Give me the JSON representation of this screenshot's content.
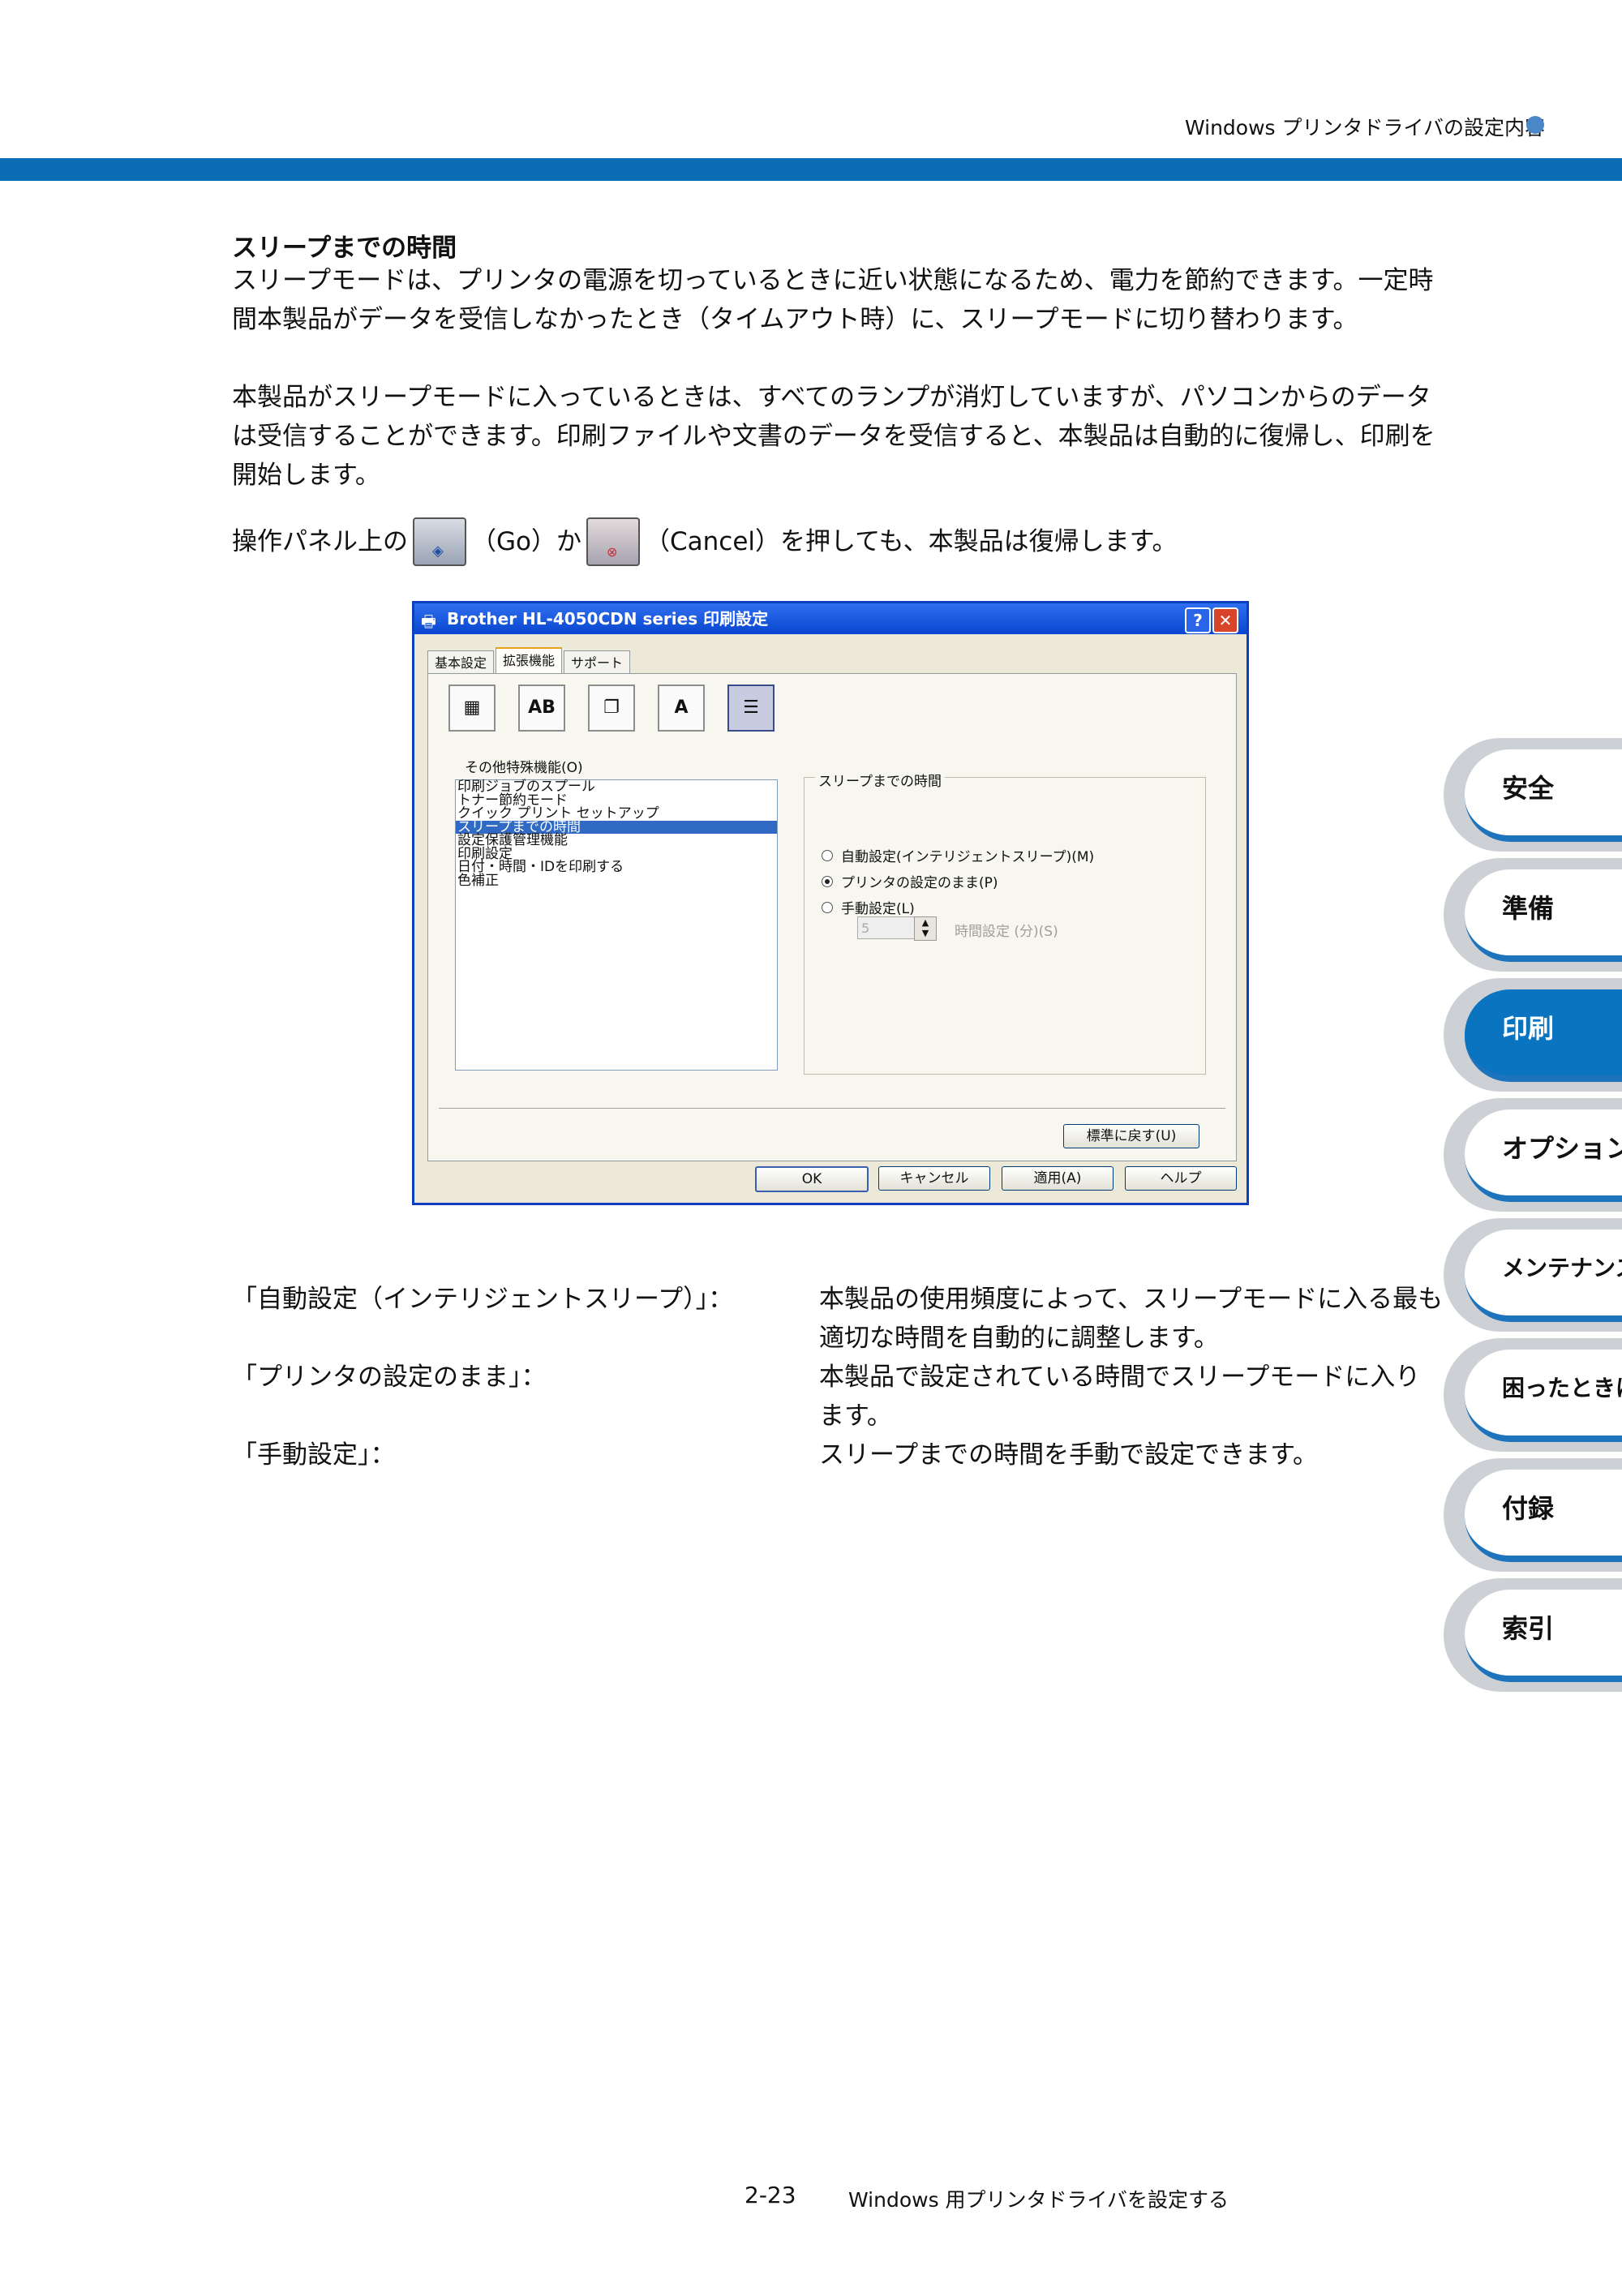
{
  "header": {
    "title": "Windows プリンタドライバの設定内容"
  },
  "section": {
    "title": "スリープまでの時間",
    "para1": "スリープモードは、プリンタの電源を切っているときに近い状態になるため、電力を節約できます。一定時間本製品がデータを受信しなかったとき（タイムアウト時）に、スリープモードに切り替わります。",
    "para2": "本製品がスリープモードに入っているときは、すべてのランプが消灯していますが、パソコンからのデータは受信することができます。印刷ファイルや文書のデータを受信すると、本製品は自動的に復帰し、印刷を開始します。",
    "go_line": {
      "prefix": "操作パネル上の",
      "go": "（Go）か",
      "cancel": "（Cancel）を押しても、本製品は復帰します。"
    }
  },
  "dialog": {
    "title": "Brother HL-4050CDN series 印刷設定",
    "tabs": [
      "基本設定",
      "拡張機能",
      "サポート"
    ],
    "active_tab": 1,
    "icons": [
      "color-icon",
      "ab-icon",
      "copy-icon",
      "font-icon",
      "settings-icon"
    ],
    "other_label": "その他特殊機能(O)",
    "features": [
      "印刷ジョブのスプール",
      "トナー節約モード",
      "クイック プリント セットアップ",
      "スリープまでの時間",
      "設定保護管理機能",
      "印刷設定",
      "日付・時間・IDを印刷する",
      "色補正"
    ],
    "selected_feature": 3,
    "group_label": "スリープまでの時間",
    "radios": [
      {
        "label": "自動設定(インテリジェントスリープ)(M)",
        "checked": false
      },
      {
        "label": "プリンタの設定のまま(P)",
        "checked": true
      },
      {
        "label": "手動設定(L)",
        "checked": false
      }
    ],
    "spin_value": "5",
    "time_label": "時間設定 (分)(S)",
    "reset_button": "標準に戻す(U)",
    "buttons": {
      "ok": "OK",
      "cancel": "キャンセル",
      "apply": "適用(A)",
      "help": "ヘルプ"
    }
  },
  "definitions": [
    {
      "term": "「自動設定（インテリジェントスリープ）」：",
      "desc": "本製品の使用頻度によって、スリープモードに入る最も適切な時間を自動的に調整します。"
    },
    {
      "term": "「プリンタの設定のまま」：",
      "desc": "本製品で設定されている時間でスリープモードに入ります。"
    },
    {
      "term": "「手動設定」：",
      "desc": "スリープまでの時間を手動で設定できます。"
    }
  ],
  "side_tabs": [
    "安全",
    "準備",
    "印刷",
    "オプション",
    "メンテナンス",
    "困ったときは",
    "付録",
    "索引"
  ],
  "active_side_tab": 2,
  "footer": {
    "page": "2-23",
    "text": "Windows 用プリンタドライバを設定する"
  },
  "colors": {
    "accent": "#0b6eb4",
    "tab_active": "#0b74c0"
  }
}
